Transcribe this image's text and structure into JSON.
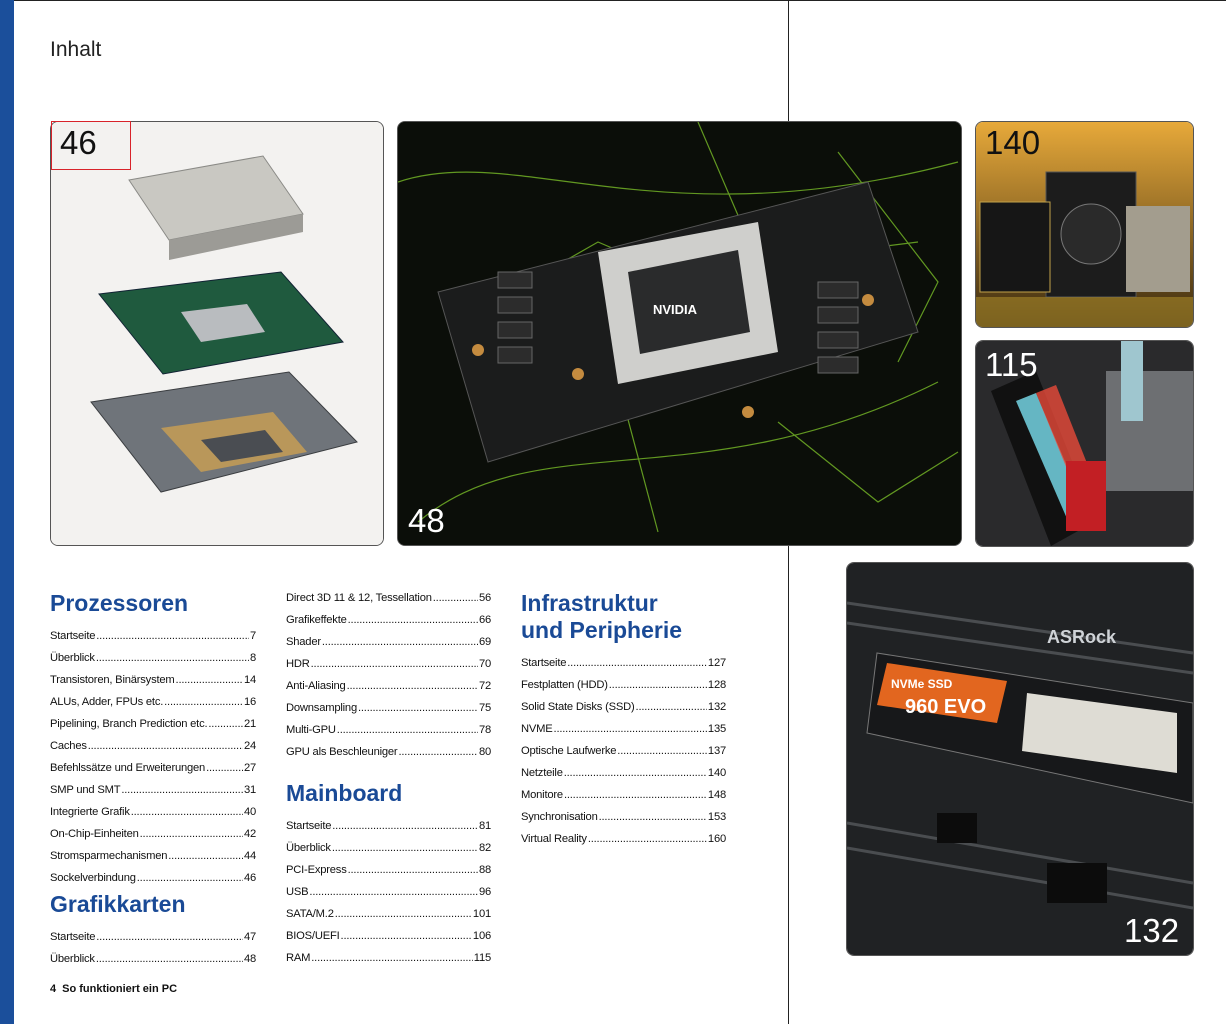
{
  "page": {
    "title": "Inhalt"
  },
  "photos": {
    "cpu": "46",
    "gpu": "48",
    "psu": "140",
    "ram": "115",
    "ssd": "132"
  },
  "columns": [
    {
      "sections": [
        {
          "heading": "Prozessoren",
          "items": [
            {
              "label": "Startseite",
              "page": "7"
            },
            {
              "label": "Überblick",
              "page": "8"
            },
            {
              "label": "Transistoren, Binärsystem",
              "page": "14"
            },
            {
              "label": "ALUs, Adder, FPUs etc.",
              "page": "16"
            },
            {
              "label": "Pipelining, Branch Prediction etc.",
              "page": "21"
            },
            {
              "label": "Caches",
              "page": "24"
            },
            {
              "label": "Befehlssätze und Erweiterungen",
              "page": "27"
            },
            {
              "label": "SMP und SMT",
              "page": "31"
            },
            {
              "label": "Integrierte Grafik",
              "page": "40"
            },
            {
              "label": "On-Chip-Einheiten",
              "page": "42"
            },
            {
              "label": "Stromsparmechanismen",
              "page": "44"
            },
            {
              "label": "Sockelverbindung",
              "page": "46"
            }
          ]
        },
        {
          "heading": "Grafikkarten",
          "items": [
            {
              "label": "Startseite",
              "page": "47"
            },
            {
              "label": "Überblick",
              "page": "48"
            }
          ]
        }
      ]
    },
    {
      "sections": [
        {
          "heading": "",
          "items": [
            {
              "label": "Direct 3D 11 & 12, Tessellation",
              "page": "56"
            },
            {
              "label": "Grafikeffekte",
              "page": "66"
            },
            {
              "label": "Shader",
              "page": "69"
            },
            {
              "label": "HDR",
              "page": "70"
            },
            {
              "label": "Anti-Aliasing",
              "page": "72"
            },
            {
              "label": "Downsampling",
              "page": "75"
            },
            {
              "label": "Multi-GPU",
              "page": "78"
            },
            {
              "label": "GPU als Beschleuniger",
              "page": "80"
            }
          ]
        },
        {
          "heading": "Mainboard",
          "items": [
            {
              "label": "Startseite",
              "page": "81"
            },
            {
              "label": "Überblick",
              "page": "82"
            },
            {
              "label": "PCI-Express",
              "page": "88"
            },
            {
              "label": "USB",
              "page": "96"
            },
            {
              "label": "SATA/M.2",
              "page": "101"
            },
            {
              "label": "BIOS/UEFI",
              "page": "106"
            },
            {
              "label": "RAM",
              "page": "115"
            }
          ]
        }
      ]
    },
    {
      "sections": [
        {
          "heading": "Infrastruktur und Peripherie",
          "items": [
            {
              "label": "Startseite",
              "page": "127"
            },
            {
              "label": "Festplatten (HDD)",
              "page": "128"
            },
            {
              "label": "Solid State Disks (SSD)",
              "page": "132"
            },
            {
              "label": "NVME",
              "page": "135"
            },
            {
              "label": "Optische Laufwerke",
              "page": "137"
            },
            {
              "label": "Netzteile",
              "page": "140"
            },
            {
              "label": "Monitore",
              "page": "148"
            },
            {
              "label": "Synchronisation",
              "page": "153"
            },
            {
              "label": "Virtual Reality",
              "page": "160"
            }
          ]
        }
      ]
    }
  ],
  "footer": {
    "page_number": "4",
    "publication": "So funktioniert ein PC"
  },
  "colors": {
    "accent": "#1a4a96",
    "spine": "#1b4f9b",
    "highlight": "#d8232a"
  }
}
